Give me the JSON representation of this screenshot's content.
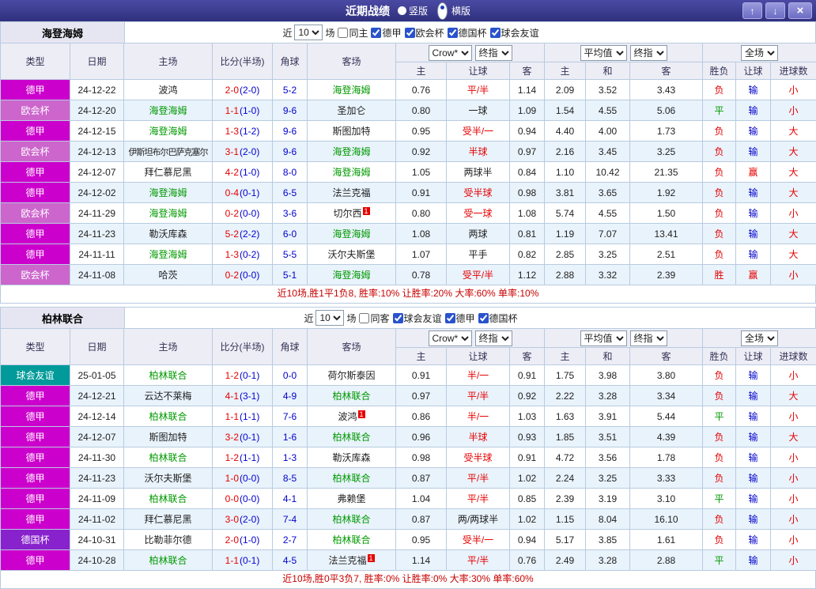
{
  "titlebar": {
    "title": "近期战绩",
    "layout_options": [
      {
        "label": "竖版",
        "selected": false
      },
      {
        "label": "横版",
        "selected": true
      }
    ],
    "buttons": {
      "up": "↑",
      "down": "↓",
      "close": "×"
    }
  },
  "league_colors": {
    "德甲": "#cc00cc",
    "欧会杯": "#cc66cc",
    "德国杯": "#8822cc",
    "球会友谊": "#009a9a"
  },
  "result_colors": {
    "胜": "#e60000",
    "平": "#009900",
    "负": "#e60000",
    "赢": "#e60000",
    "输": "#0000cc",
    "大": "#e60000",
    "小": "#e60000"
  },
  "header": {
    "static_cols": [
      "类型",
      "日期",
      "主场",
      "比分(半场)",
      "角球",
      "客场"
    ],
    "asia_selects": [
      "Crow*",
      "终指"
    ],
    "asia_subs": [
      "主",
      "让球",
      "客"
    ],
    "euro_selects": [
      "平均值",
      "终指"
    ],
    "euro_subs": [
      "主",
      "和",
      "客"
    ],
    "result_select": "全场",
    "result_subs": [
      "胜负",
      "让球",
      "进球数"
    ]
  },
  "sections": [
    {
      "team": "海登海姆",
      "filter": {
        "prefix": "近",
        "count": "10",
        "suffix": "场",
        "checkboxes": [
          {
            "label": "同主",
            "checked": false
          },
          {
            "label": "德甲",
            "checked": true
          },
          {
            "label": "欧会杯",
            "checked": true
          },
          {
            "label": "德国杯",
            "checked": true
          },
          {
            "label": "球会友谊",
            "checked": true
          }
        ]
      },
      "rows": [
        {
          "lg": "德甲",
          "date": "24-12-22",
          "home": "波鸿",
          "hf": false,
          "hb": "",
          "ft": "2-0",
          "ht": "(2-0)",
          "cr": "5-2",
          "away": "海登海姆",
          "af": true,
          "ab": "",
          "asia": [
            "0.76",
            "平/半",
            "1.14"
          ],
          "lr": true,
          "euro": [
            "2.09",
            "3.52",
            "3.43"
          ],
          "res": [
            "负",
            "输",
            "小"
          ]
        },
        {
          "lg": "欧会杯",
          "date": "24-12-20",
          "home": "海登海姆",
          "hf": true,
          "hb": "",
          "ft": "1-1",
          "ht": "(1-0)",
          "cr": "9-6",
          "away": "圣加仑",
          "af": false,
          "ab": "",
          "asia": [
            "0.80",
            "一球",
            "1.09"
          ],
          "lr": false,
          "euro": [
            "1.54",
            "4.55",
            "5.06"
          ],
          "res": [
            "平",
            "输",
            "小"
          ]
        },
        {
          "lg": "德甲",
          "date": "24-12-15",
          "home": "海登海姆",
          "hf": true,
          "hb": "",
          "ft": "1-3",
          "ht": "(1-2)",
          "cr": "9-6",
          "away": "斯图加特",
          "af": false,
          "ab": "",
          "asia": [
            "0.95",
            "受半/一",
            "0.94"
          ],
          "lr": true,
          "euro": [
            "4.40",
            "4.00",
            "1.73"
          ],
          "res": [
            "负",
            "输",
            "大"
          ]
        },
        {
          "lg": "欧会杯",
          "date": "24-12-13",
          "home": "伊斯坦布尔巴萨克塞尔",
          "hf": false,
          "hb": "",
          "ft": "3-1",
          "ht": "(2-0)",
          "cr": "9-6",
          "away": "海登海姆",
          "af": true,
          "ab": "",
          "asia": [
            "0.92",
            "半球",
            "0.97"
          ],
          "lr": true,
          "euro": [
            "2.16",
            "3.45",
            "3.25"
          ],
          "res": [
            "负",
            "输",
            "大"
          ]
        },
        {
          "lg": "德甲",
          "date": "24-12-07",
          "home": "拜仁慕尼黑",
          "hf": false,
          "hb": "",
          "ft": "4-2",
          "ht": "(1-0)",
          "cr": "8-0",
          "away": "海登海姆",
          "af": true,
          "ab": "",
          "asia": [
            "1.05",
            "两球半",
            "0.84"
          ],
          "lr": false,
          "euro": [
            "1.10",
            "10.42",
            "21.35"
          ],
          "res": [
            "负",
            "赢",
            "大"
          ]
        },
        {
          "lg": "德甲",
          "date": "24-12-02",
          "home": "海登海姆",
          "hf": true,
          "hb": "",
          "ft": "0-4",
          "ht": "(0-1)",
          "cr": "6-5",
          "away": "法兰克福",
          "af": false,
          "ab": "",
          "asia": [
            "0.91",
            "受半球",
            "0.98"
          ],
          "lr": true,
          "euro": [
            "3.81",
            "3.65",
            "1.92"
          ],
          "res": [
            "负",
            "输",
            "大"
          ]
        },
        {
          "lg": "欧会杯",
          "date": "24-11-29",
          "home": "海登海姆",
          "hf": true,
          "hb": "",
          "ft": "0-2",
          "ht": "(0-0)",
          "cr": "3-6",
          "away": "切尔西",
          "af": false,
          "ab": "1",
          "asia": [
            "0.80",
            "受一球",
            "1.08"
          ],
          "lr": true,
          "euro": [
            "5.74",
            "4.55",
            "1.50"
          ],
          "res": [
            "负",
            "输",
            "小"
          ]
        },
        {
          "lg": "德甲",
          "date": "24-11-23",
          "home": "勒沃库森",
          "hf": false,
          "hb": "",
          "ft": "5-2",
          "ht": "(2-2)",
          "cr": "6-0",
          "away": "海登海姆",
          "af": true,
          "ab": "",
          "asia": [
            "1.08",
            "两球",
            "0.81"
          ],
          "lr": false,
          "euro": [
            "1.19",
            "7.07",
            "13.41"
          ],
          "res": [
            "负",
            "输",
            "大"
          ]
        },
        {
          "lg": "德甲",
          "date": "24-11-11",
          "home": "海登海姆",
          "hf": true,
          "hb": "",
          "ft": "1-3",
          "ht": "(0-2)",
          "cr": "5-5",
          "away": "沃尔夫斯堡",
          "af": false,
          "ab": "",
          "asia": [
            "1.07",
            "平手",
            "0.82"
          ],
          "lr": false,
          "euro": [
            "2.85",
            "3.25",
            "2.51"
          ],
          "res": [
            "负",
            "输",
            "大"
          ]
        },
        {
          "lg": "欧会杯",
          "date": "24-11-08",
          "home": "哈茨",
          "hf": false,
          "hb": "",
          "ft": "0-2",
          "ht": "(0-0)",
          "cr": "5-1",
          "away": "海登海姆",
          "af": true,
          "ab": "",
          "asia": [
            "0.78",
            "受平/半",
            "1.12"
          ],
          "lr": true,
          "euro": [
            "2.88",
            "3.32",
            "2.39"
          ],
          "res": [
            "胜",
            "赢",
            "小"
          ]
        }
      ],
      "summary": "近10场,胜1平1负8, 胜率:10% 让胜率:20% 大率:60% 单率:10%"
    },
    {
      "team": "柏林联合",
      "filter": {
        "prefix": "近",
        "count": "10",
        "suffix": "场",
        "checkboxes": [
          {
            "label": "同客",
            "checked": false
          },
          {
            "label": "球会友谊",
            "checked": true
          },
          {
            "label": "德甲",
            "checked": true
          },
          {
            "label": "德国杯",
            "checked": true
          }
        ]
      },
      "rows": [
        {
          "lg": "球会友谊",
          "date": "25-01-05",
          "home": "柏林联合",
          "hf": true,
          "hb": "",
          "ft": "1-2",
          "ht": "(0-1)",
          "cr": "0-0",
          "away": "荷尔斯泰因",
          "af": false,
          "ab": "",
          "asia": [
            "0.91",
            "半/一",
            "0.91"
          ],
          "lr": true,
          "euro": [
            "1.75",
            "3.98",
            "3.80"
          ],
          "res": [
            "负",
            "输",
            "小"
          ]
        },
        {
          "lg": "德甲",
          "date": "24-12-21",
          "home": "云达不莱梅",
          "hf": false,
          "hb": "",
          "ft": "4-1",
          "ht": "(3-1)",
          "cr": "4-9",
          "away": "柏林联合",
          "af": true,
          "ab": "",
          "asia": [
            "0.97",
            "平/半",
            "0.92"
          ],
          "lr": true,
          "euro": [
            "2.22",
            "3.28",
            "3.34"
          ],
          "res": [
            "负",
            "输",
            "大"
          ]
        },
        {
          "lg": "德甲",
          "date": "24-12-14",
          "home": "柏林联合",
          "hf": true,
          "hb": "",
          "ft": "1-1",
          "ht": "(1-1)",
          "cr": "7-6",
          "away": "波鸿",
          "af": false,
          "ab": "1",
          "asia": [
            "0.86",
            "半/一",
            "1.03"
          ],
          "lr": true,
          "euro": [
            "1.63",
            "3.91",
            "5.44"
          ],
          "res": [
            "平",
            "输",
            "小"
          ]
        },
        {
          "lg": "德甲",
          "date": "24-12-07",
          "home": "斯图加特",
          "hf": false,
          "hb": "",
          "ft": "3-2",
          "ht": "(0-1)",
          "cr": "1-6",
          "away": "柏林联合",
          "af": true,
          "ab": "",
          "asia": [
            "0.96",
            "半球",
            "0.93"
          ],
          "lr": true,
          "euro": [
            "1.85",
            "3.51",
            "4.39"
          ],
          "res": [
            "负",
            "输",
            "大"
          ]
        },
        {
          "lg": "德甲",
          "date": "24-11-30",
          "home": "柏林联合",
          "hf": true,
          "hb": "",
          "ft": "1-2",
          "ht": "(1-1)",
          "cr": "1-3",
          "away": "勒沃库森",
          "af": false,
          "ab": "",
          "asia": [
            "0.98",
            "受半球",
            "0.91"
          ],
          "lr": true,
          "euro": [
            "4.72",
            "3.56",
            "1.78"
          ],
          "res": [
            "负",
            "输",
            "小"
          ]
        },
        {
          "lg": "德甲",
          "date": "24-11-23",
          "home": "沃尔夫斯堡",
          "hf": false,
          "hb": "",
          "ft": "1-0",
          "ht": "(0-0)",
          "cr": "8-5",
          "away": "柏林联合",
          "af": true,
          "ab": "",
          "asia": [
            "0.87",
            "平/半",
            "1.02"
          ],
          "lr": true,
          "euro": [
            "2.24",
            "3.25",
            "3.33"
          ],
          "res": [
            "负",
            "输",
            "小"
          ]
        },
        {
          "lg": "德甲",
          "date": "24-11-09",
          "home": "柏林联合",
          "hf": true,
          "hb": "",
          "ft": "0-0",
          "ht": "(0-0)",
          "cr": "4-1",
          "away": "弗赖堡",
          "af": false,
          "ab": "",
          "asia": [
            "1.04",
            "平/半",
            "0.85"
          ],
          "lr": true,
          "euro": [
            "2.39",
            "3.19",
            "3.10"
          ],
          "res": [
            "平",
            "输",
            "小"
          ]
        },
        {
          "lg": "德甲",
          "date": "24-11-02",
          "home": "拜仁慕尼黑",
          "hf": false,
          "hb": "",
          "ft": "3-0",
          "ht": "(2-0)",
          "cr": "7-4",
          "away": "柏林联合",
          "af": true,
          "ab": "",
          "asia": [
            "0.87",
            "两/两球半",
            "1.02"
          ],
          "lr": false,
          "euro": [
            "1.15",
            "8.04",
            "16.10"
          ],
          "res": [
            "负",
            "输",
            "小"
          ]
        },
        {
          "lg": "德国杯",
          "date": "24-10-31",
          "home": "比勒菲尔德",
          "hf": false,
          "hb": "",
          "ft": "2-0",
          "ht": "(1-0)",
          "cr": "2-7",
          "away": "柏林联合",
          "af": true,
          "ab": "",
          "asia": [
            "0.95",
            "受半/一",
            "0.94"
          ],
          "lr": true,
          "euro": [
            "5.17",
            "3.85",
            "1.61"
          ],
          "res": [
            "负",
            "输",
            "小"
          ]
        },
        {
          "lg": "德甲",
          "date": "24-10-28",
          "home": "柏林联合",
          "hf": true,
          "hb": "",
          "ft": "1-1",
          "ht": "(0-1)",
          "cr": "4-5",
          "away": "法兰克福",
          "af": false,
          "ab": "1",
          "asia": [
            "1.14",
            "平/半",
            "0.76"
          ],
          "lr": true,
          "euro": [
            "2.49",
            "3.28",
            "2.88"
          ],
          "res": [
            "平",
            "输",
            "小"
          ]
        }
      ],
      "summary": "近10场,胜0平3负7, 胜率:0% 让胜率:0% 大率:30% 单率:60%"
    }
  ]
}
